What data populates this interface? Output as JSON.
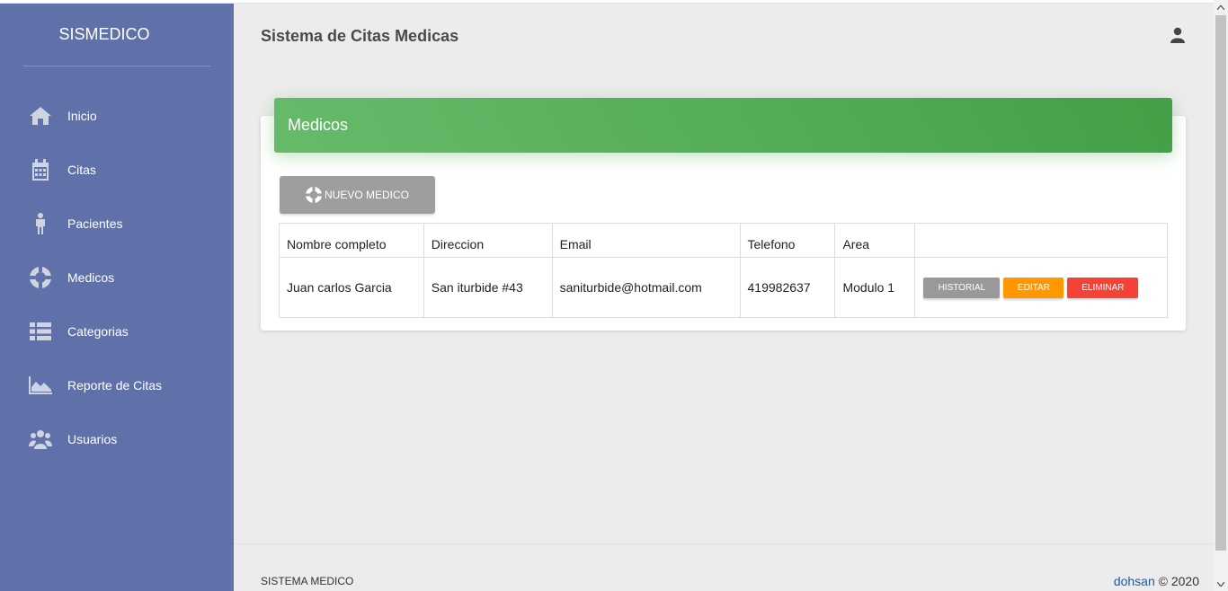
{
  "sidebar": {
    "brand": "SISMEDICO",
    "items": [
      {
        "label": "Inicio",
        "icon": "home-icon"
      },
      {
        "label": "Citas",
        "icon": "calendar-icon"
      },
      {
        "label": "Pacientes",
        "icon": "person-icon"
      },
      {
        "label": "Medicos",
        "icon": "lifebuoy-icon"
      },
      {
        "label": "Categorias",
        "icon": "list-icon"
      },
      {
        "label": "Reporte de Citas",
        "icon": "area-chart-icon"
      },
      {
        "label": "Usuarios",
        "icon": "users-icon"
      }
    ]
  },
  "header": {
    "title": "Sistema de Citas Medicas",
    "user_icon": "user-icon"
  },
  "card": {
    "title": "Medicos",
    "new_button": "NUEVO MEDICO",
    "columns": [
      "Nombre completo",
      "Direccion",
      "Email",
      "Telefono",
      "Area",
      ""
    ],
    "rows": [
      {
        "nombre": "Juan carlos Garcia",
        "direccion": "San iturbide #43",
        "email": "saniturbide@hotmail.com",
        "telefono": "419982637",
        "area": "Modulo 1",
        "actions": {
          "historial": "HISTORIAL",
          "editar": "EDITAR",
          "eliminar": "ELIMINAR"
        }
      }
    ]
  },
  "footer": {
    "left": "SISTEMA MEDICO",
    "author": "dohsan",
    "copyright": "© 2020"
  },
  "colors": {
    "sidebar_bg": "#5f71a8",
    "header_green": "#4caf50",
    "btn_default": "#999999",
    "btn_warning": "#ff9800",
    "btn_danger": "#f44336"
  }
}
